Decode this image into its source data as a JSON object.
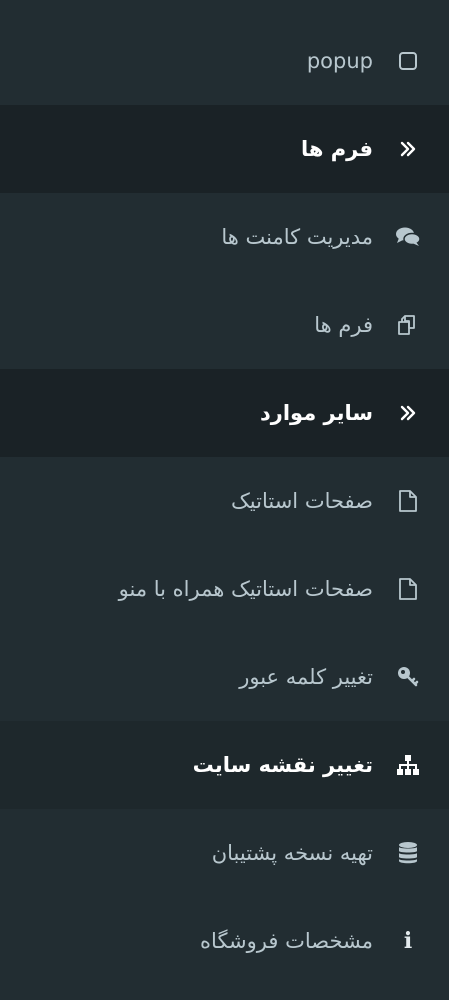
{
  "menu": {
    "popup": {
      "label": "popup",
      "icon": "square-outline-icon"
    },
    "forms_header": {
      "label": "فرم ها",
      "icon": "double-chevron-icon"
    },
    "comments": {
      "label": "مدیریت کامنت ها",
      "icon": "comments-icon"
    },
    "forms": {
      "label": "فرم ها",
      "icon": "copy-icon"
    },
    "others_header": {
      "label": "سایر موارد",
      "icon": "double-chevron-icon"
    },
    "static_pages": {
      "label": "صفحات استاتیک",
      "icon": "file-icon"
    },
    "static_pages_menu": {
      "label": "صفحات استاتیک همراه با منو",
      "icon": "file-icon"
    },
    "change_password": {
      "label": "تغییر کلمه عبور",
      "icon": "key-icon"
    },
    "change_sitemap": {
      "label": "تغییر نقشه سایت",
      "icon": "sitemap-icon"
    },
    "backup": {
      "label": "تهیه نسخه پشتیبان",
      "icon": "database-icon"
    },
    "store_info": {
      "label": "مشخصات فروشگاه",
      "icon": "info-icon"
    }
  },
  "colors": {
    "sidebar_bg": "#222d32",
    "header_bg": "#1a2226",
    "text": "#b8c7ce",
    "active_text": "#ffffff"
  }
}
